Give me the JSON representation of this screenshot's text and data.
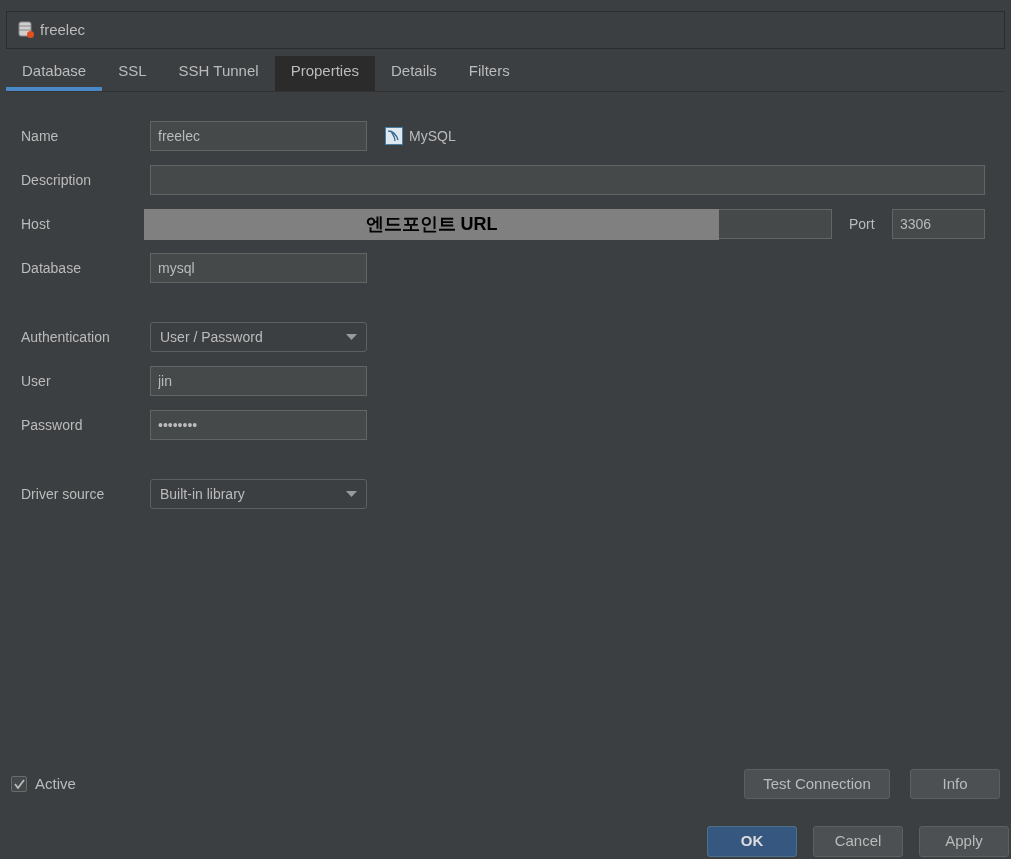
{
  "header": {
    "title": "freelec"
  },
  "tabs": [
    {
      "label": "Database",
      "selected": true,
      "highlighted": false
    },
    {
      "label": "SSL",
      "selected": false,
      "highlighted": false
    },
    {
      "label": "SSH Tunnel",
      "selected": false,
      "highlighted": false
    },
    {
      "label": "Properties",
      "selected": false,
      "highlighted": true
    },
    {
      "label": "Details",
      "selected": false,
      "highlighted": false
    },
    {
      "label": "Filters",
      "selected": false,
      "highlighted": false
    }
  ],
  "form": {
    "name": {
      "label": "Name",
      "value": "freelec",
      "driver": "MySQL"
    },
    "description": {
      "label": "Description"
    },
    "host": {
      "label": "Host",
      "overlay": "엔드포인트 URL",
      "port_label": "Port",
      "port": "3306"
    },
    "database": {
      "label": "Database",
      "value": "mysql"
    },
    "authentication": {
      "label": "Authentication",
      "value": "User / Password"
    },
    "user": {
      "label": "User",
      "value": "jin"
    },
    "password": {
      "label": "Password",
      "value": "••••••••"
    },
    "driver_source": {
      "label": "Driver source",
      "value": "Built-in library"
    }
  },
  "active": {
    "label": "Active",
    "checked": true
  },
  "buttons": [
    {
      "label": "Test Connection"
    },
    {
      "label": "Info"
    }
  ],
  "dialog_buttons": [
    {
      "label": "OK",
      "kind": "primary"
    },
    {
      "label": "Cancel",
      "kind": "secondary"
    },
    {
      "label": "Apply",
      "kind": "secondary"
    }
  ]
}
